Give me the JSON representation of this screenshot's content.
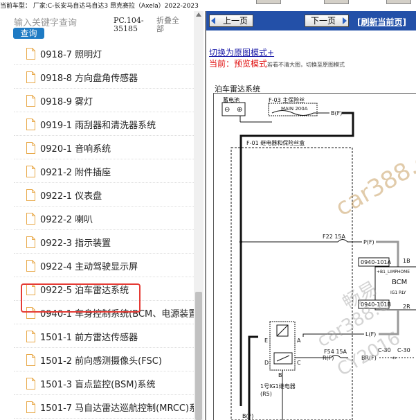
{
  "topbar": {
    "vehicle_info": "当前车型： 厂家:C-长安马自达马自达3 昂克赛拉（Axela）2022-2023"
  },
  "left_panel": {
    "search": {
      "placeholder": "输入关键字查询",
      "button_label": "查询"
    },
    "pc_code": "PC.104-35185",
    "collapse_all": "折叠全部",
    "items": [
      {
        "label": "0918-7 照明灯"
      },
      {
        "label": "0918-8 方向盘角传感器"
      },
      {
        "label": "0918-9 雾灯"
      },
      {
        "label": "0919-1 雨刮器和清洗器系统"
      },
      {
        "label": "0920-1 音响系统"
      },
      {
        "label": "0921-2 附件插座"
      },
      {
        "label": "0922-1 仪表盘"
      },
      {
        "label": "0922-2 喇叭"
      },
      {
        "label": "0922-3 指示装置"
      },
      {
        "label": "0922-4 主动驾驶显示屏"
      },
      {
        "label": "0922-5 泊车雷达系统",
        "selected": true
      },
      {
        "label": "0940-1 车身控制系统(BCM、电源装置"
      },
      {
        "label": "1501-1 前方雷达传感器"
      },
      {
        "label": "1501-2 前向感测摄像头(FSC)"
      },
      {
        "label": "1501-3 盲点监控(BSM)系统"
      },
      {
        "label": "1501-7 马自达雷达巡航控制(MRCC)系"
      }
    ],
    "highlight_color": "#e53b35"
  },
  "right_panel": {
    "nav": {
      "prev_label": "上一页",
      "next_label": "下一页",
      "refresh_label": "[刷新当前页]"
    },
    "switch_mode_link": "切换为原图模式+",
    "mode_status": {
      "prefix": "当前：",
      "mode": "预览模式",
      "hint": "若看不清大图，切换至原图模式"
    },
    "diagram": {
      "title": "泊车雷达系统",
      "battery_label": "蓄电池",
      "minus_symbol": "⊖",
      "plus_symbol": "⊕",
      "main_fuse_code": "F-03 主保险丝",
      "main_fuse_rating": "MAIN 200A",
      "main_wire": "B(F)",
      "relay_box_label": "F-01 继电器和保险丝盒",
      "fuse_f22": "F22 15A",
      "wire_pf": "P(F)",
      "connector_a": "0940-101A",
      "pin_1b": "1B",
      "bcm_header": "+B1_LIMPHOME",
      "bcm_label": "BCM",
      "bcm_relay": "IG1 RLY",
      "connector_b": "0940-101B",
      "pin_2r": "2R",
      "wire_lf": "L(F)",
      "relay_pin_e": "E",
      "relay_pin_a": "A",
      "relay_pin_d": "D",
      "relay_pin_c": "C",
      "relay_pin_b": "B",
      "fuse_f54": "F54 15A",
      "wire_rf": "R(F)",
      "wire_brf": "BR(F)",
      "c30_left": "C-30",
      "c30_right": "C-30",
      "relay_name": "1号IG1继电器",
      "relay_code": "(R5)",
      "bottom_wire": "B(F)"
    },
    "watermarks": [
      "car388.c",
      "畅易",
      "car388.c",
      "CY2016"
    ],
    "nav_bar_color": "#2350a8",
    "accent_red": "#e01010"
  }
}
